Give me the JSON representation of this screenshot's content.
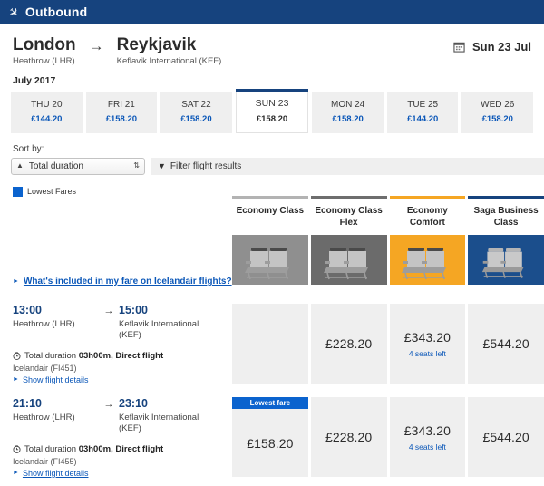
{
  "topbar": {
    "title": "Outbound",
    "plane_icon": "airplane-icon"
  },
  "route": {
    "origin_city": "London",
    "origin_airport": "Heathrow (LHR)",
    "arrow": "→",
    "dest_city": "Reykjavik",
    "dest_airport": "Keflavik International (KEF)",
    "date_label": "Sun 23 Jul",
    "calendar_icon": "calendar-icon"
  },
  "month_label": "July 2017",
  "date_tabs": [
    {
      "dow": "THU 20",
      "price": "£144.20",
      "selected": false
    },
    {
      "dow": "FRI 21",
      "price": "£158.20",
      "selected": false
    },
    {
      "dow": "SAT 22",
      "price": "£158.20",
      "selected": false
    },
    {
      "dow": "SUN 23",
      "price": "£158.20",
      "selected": true
    },
    {
      "dow": "MON 24",
      "price": "£158.20",
      "selected": false
    },
    {
      "dow": "TUE 25",
      "price": "£144.20",
      "selected": false
    },
    {
      "dow": "WED 26",
      "price": "£158.20",
      "selected": false
    }
  ],
  "toolbar": {
    "sort_label": "Sort by:",
    "sort_value": "Total duration",
    "filter_label": "Filter flight results",
    "filter_icon": "funnel-icon"
  },
  "legend": {
    "label": "Lowest Fares",
    "color": "#0b63ce"
  },
  "fare_classes": [
    {
      "name": "Economy Class",
      "bar_color": "#b3b3b3",
      "panel_color": "#8f8f8f"
    },
    {
      "name": "Economy Class Flex",
      "bar_color": "#6e6e6e",
      "panel_color": "#6b6b6b"
    },
    {
      "name": "Economy Comfort",
      "bar_color": "#f5a623",
      "panel_color": "#f5a623"
    },
    {
      "name": "Saga Business Class",
      "bar_color": "#16437E",
      "panel_color": "#1b4e8c"
    }
  ],
  "included_link": "What's included in my fare on Icelandair flights?",
  "flights": [
    {
      "depart_time": "13:00",
      "depart_place": "Heathrow (LHR)",
      "arrive_time": "15:00",
      "arrive_place": "Keflavik International (KEF)",
      "duration_prefix": "Total duration",
      "duration": "03h00m",
      "stops": ", Direct flight",
      "carrier": "Icelandair (FI451)",
      "details_label": "Show flight details",
      "fares": [
        {
          "price": "",
          "seats": "",
          "lowest": false
        },
        {
          "price": "£228.20",
          "seats": "",
          "lowest": false
        },
        {
          "price": "£343.20",
          "seats": "4 seats left",
          "lowest": false
        },
        {
          "price": "£544.20",
          "seats": "",
          "lowest": false
        }
      ]
    },
    {
      "depart_time": "21:10",
      "depart_place": "Heathrow (LHR)",
      "arrive_time": "23:10",
      "arrive_place": "Keflavik International (KEF)",
      "duration_prefix": "Total duration",
      "duration": "03h00m",
      "stops": ", Direct flight",
      "carrier": "Icelandair (FI455)",
      "details_label": "Show flight details",
      "fares": [
        {
          "price": "£158.20",
          "seats": "",
          "lowest": true,
          "lowest_label": "Lowest fare"
        },
        {
          "price": "£228.20",
          "seats": "",
          "lowest": false
        },
        {
          "price": "£343.20",
          "seats": "4 seats left",
          "lowest": false
        },
        {
          "price": "£544.20",
          "seats": "",
          "lowest": false
        }
      ]
    }
  ]
}
